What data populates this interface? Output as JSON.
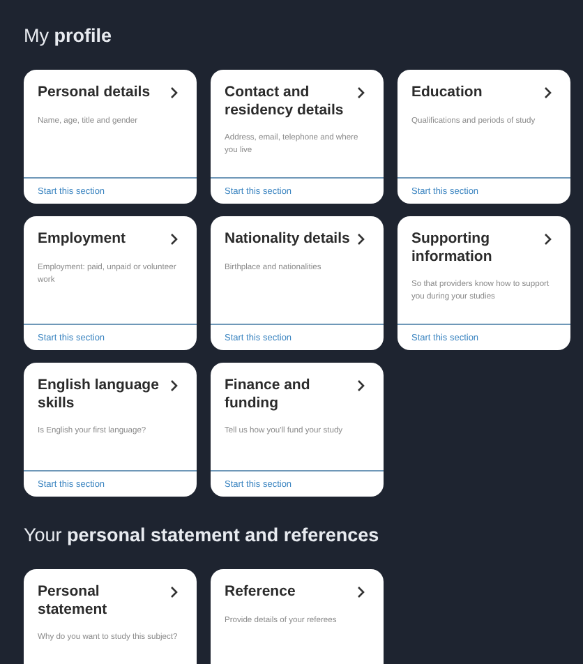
{
  "sections": [
    {
      "heading": "My **profile**",
      "cards": [
        {
          "title": "Personal details",
          "description": "Name, age, title and gender",
          "action": "Start this section"
        },
        {
          "title": "Contact and residency details",
          "description": "Address, email, telephone and where you live",
          "action": "Start this section"
        },
        {
          "title": "Education",
          "description": "Qualifications and periods of study",
          "action": "Start this section"
        },
        {
          "title": "Employment",
          "description": "Employment: paid, unpaid or volunteer work",
          "action": "Start this section"
        },
        {
          "title": "Nationality details",
          "description": "Birthplace and nationalities",
          "action": "Start this section"
        },
        {
          "title": "Supporting information",
          "description": "So that providers know how to support you during your studies",
          "action": "Start this section"
        },
        {
          "title": "English language skills",
          "description": "Is English your first language?",
          "action": "Start this section"
        },
        {
          "title": "Finance and funding",
          "description": "Tell us how you'll fund your study",
          "action": "Start this section"
        }
      ]
    },
    {
      "heading": "Your **personal statement and references**",
      "cards": [
        {
          "title": "Personal statement",
          "description": "Why do you want to study this subject?"
        },
        {
          "title": "Reference",
          "description": "Provide details of your referees"
        }
      ]
    }
  ]
}
